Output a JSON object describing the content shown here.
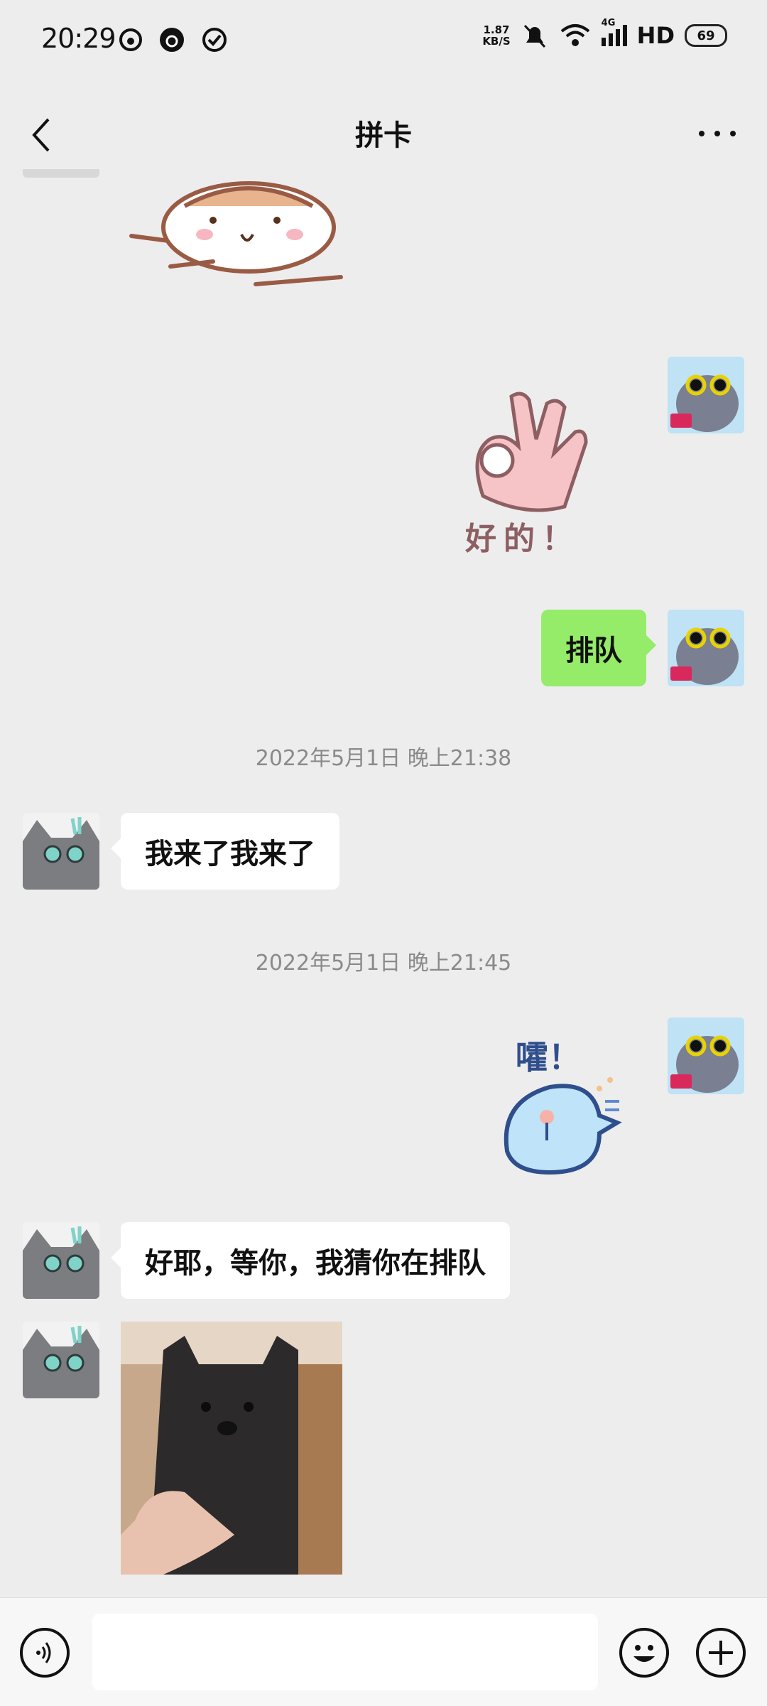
{
  "status_bar": {
    "time": "20:29",
    "net_speed_value": "1.87",
    "net_speed_unit": "KB/S",
    "network_label": "4G",
    "hd_label": "HD",
    "battery": "69",
    "icons": [
      "weibo-icon",
      "app-icon",
      "check-circle-icon",
      "mute-icon",
      "wifi-icon",
      "signal-icon"
    ]
  },
  "nav": {
    "title": "拼卡",
    "back_icon": "chevron-left-icon",
    "more_icon": "more-icon"
  },
  "messages": [
    {
      "side": "other",
      "type": "sticker",
      "sticker": "hamster-sticker"
    },
    {
      "side": "me",
      "type": "sticker",
      "sticker": "ok-hand-sticker",
      "caption": "好的！"
    },
    {
      "side": "me",
      "type": "text",
      "text": "排队"
    },
    {
      "type": "timestamp",
      "text": "2022年5月1日 晚上21:38"
    },
    {
      "side": "other",
      "type": "text",
      "text": "我来了我来了"
    },
    {
      "type": "timestamp",
      "text": "2022年5月1日 晚上21:45"
    },
    {
      "side": "me",
      "type": "sticker",
      "sticker": "blue-bird-sticker",
      "caption": "嚯！"
    },
    {
      "side": "other",
      "type": "text",
      "text": "好耶，等你，我猜你在排队"
    },
    {
      "side": "other",
      "type": "image",
      "image": "black-animal-photo"
    }
  ],
  "input_bar": {
    "placeholder": "",
    "voice_icon": "voice-icon",
    "emoji_icon": "emoji-icon",
    "plus_icon": "plus-icon"
  },
  "colors": {
    "background": "#ededed",
    "my_bubble": "#95ec69",
    "other_bubble": "#ffffff",
    "timestamp": "#8a8a8a"
  }
}
